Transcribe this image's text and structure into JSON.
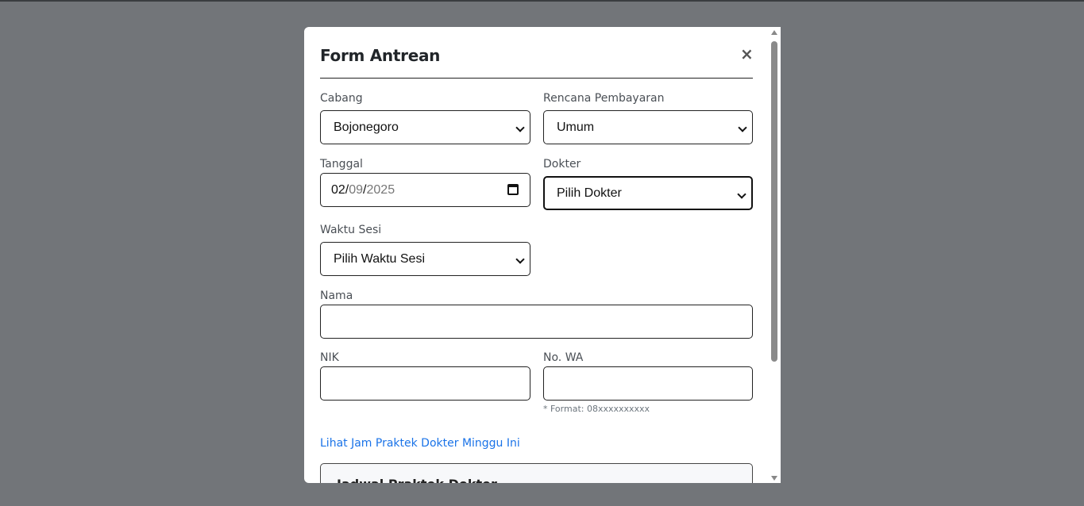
{
  "modal": {
    "title": "Form Antrean",
    "close_symbol": "×"
  },
  "form": {
    "cabang": {
      "label": "Cabang",
      "value": "Bojonegoro"
    },
    "rencana": {
      "label": "Rencana Pembayaran",
      "value": "Umum"
    },
    "tanggal": {
      "label": "Tanggal",
      "day": "02",
      "sep1": "/",
      "month": "09",
      "sep2": "/",
      "year": "2025"
    },
    "dokter": {
      "label": "Dokter",
      "value": "Pilih Dokter"
    },
    "waktu": {
      "label": "Waktu Sesi",
      "value": "Pilih Waktu Sesi"
    },
    "nama": {
      "label": "Nama",
      "value": ""
    },
    "nik": {
      "label": "NIK",
      "value": ""
    },
    "wa": {
      "label": "No. WA",
      "value": "",
      "hint": "* Format: 08xxxxxxxxxx"
    }
  },
  "link_text": "Lihat Jam Praktek Dokter Minggu Ini",
  "panel": {
    "title": "Jadwal Praktek Dokter"
  },
  "icons": {
    "close": "close-icon",
    "calendar": "calendar-icon"
  }
}
